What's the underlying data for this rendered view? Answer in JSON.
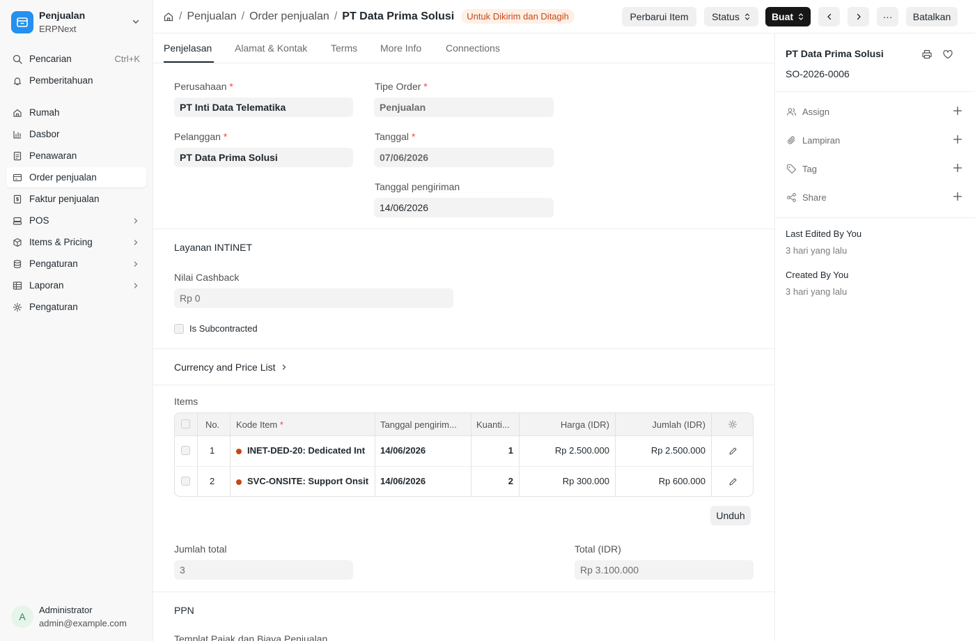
{
  "sidebar": {
    "app_title": "Penjualan",
    "app_subtitle": "ERPNext",
    "search_label": "Pencarian",
    "search_shortcut": "Ctrl+K",
    "notifications_label": "Pemberitahuan",
    "items": [
      {
        "label": "Rumah",
        "icon": "home-icon"
      },
      {
        "label": "Dasbor",
        "icon": "bar-chart-icon"
      },
      {
        "label": "Penawaran",
        "icon": "document-icon"
      },
      {
        "label": "Order penjualan",
        "icon": "card-icon",
        "active": true
      },
      {
        "label": "Faktur penjualan",
        "icon": "invoice-icon"
      },
      {
        "label": "POS",
        "icon": "pos-icon",
        "has_children": true
      },
      {
        "label": "Items & Pricing",
        "icon": "package-icon",
        "has_children": true
      },
      {
        "label": "Pengaturan",
        "icon": "database-icon",
        "has_children": true
      },
      {
        "label": "Laporan",
        "icon": "table-icon",
        "has_children": true
      },
      {
        "label": "Pengaturan",
        "icon": "gear-icon"
      }
    ],
    "user": {
      "initial": "A",
      "name": "Administrator",
      "email": "admin@example.com"
    }
  },
  "header": {
    "breadcrumbs": [
      "Penjualan",
      "Order penjualan"
    ],
    "title": "PT Data Prima Solusi",
    "status": "Untuk Dikirim dan Ditagih",
    "actions": {
      "update_items": "Perbarui Item",
      "status": "Status",
      "create": "Buat",
      "more": "···",
      "cancel": "Batalkan"
    }
  },
  "tabs": [
    "Penjelasan",
    "Alamat & Kontak",
    "Terms",
    "More Info",
    "Connections"
  ],
  "form": {
    "company_label": "Perusahaan",
    "company": "PT Inti Data Telematika",
    "customer_label": "Pelanggan",
    "customer": "PT Data Prima Solusi",
    "order_type_label": "Tipe Order",
    "order_type": "Penjualan",
    "date_label": "Tanggal",
    "date": "07/06/2026",
    "delivery_date_label": "Tanggal pengiriman",
    "delivery_date": "14/06/2026",
    "section_intinet": "Layanan INTINET",
    "cashback_label": "Nilai Cashback",
    "cashback": "Rp 0",
    "subcontracted_label": "Is Subcontracted",
    "currency_section": "Currency and Price List",
    "items_label": "Items",
    "download_label": "Unduh",
    "total_qty_label": "Jumlah total",
    "total_qty": "3",
    "total_label": "Total (IDR)",
    "total": "Rp 3.100.000",
    "ppn_section": "PPN",
    "tax_template_label": "Templat Pajak dan Biaya Penjualan"
  },
  "items_table": {
    "columns": [
      "No.",
      "Kode Item",
      "Tanggal pengirim...",
      "Kuanti...",
      "Harga (IDR)",
      "Jumlah (IDR)"
    ],
    "rows": [
      {
        "no": "1",
        "item_code": "INET-DED-20: Dedicated Int",
        "delivery_date": "14/06/2026",
        "qty": "1",
        "rate": "Rp 2.500.000",
        "amount": "Rp 2.500.000"
      },
      {
        "no": "2",
        "item_code": "SVC-ONSITE: Support Onsit",
        "delivery_date": "14/06/2026",
        "qty": "2",
        "rate": "Rp 300.000",
        "amount": "Rp 600.000"
      }
    ]
  },
  "right_panel": {
    "title": "PT Data Prima Solusi",
    "doc_id": "SO-2026-0006",
    "assign": "Assign",
    "attachments": "Lampiran",
    "tags": "Tag",
    "share": "Share",
    "last_edited": "Last Edited By You",
    "last_edited_time": "3 hari yang lalu",
    "created": "Created By You",
    "created_time": "3 hari yang lalu"
  },
  "colors": {
    "accent": "#2490ef",
    "status_bg": "#fff0e6",
    "status_text": "#c4481a",
    "primary_button": "#171717"
  }
}
